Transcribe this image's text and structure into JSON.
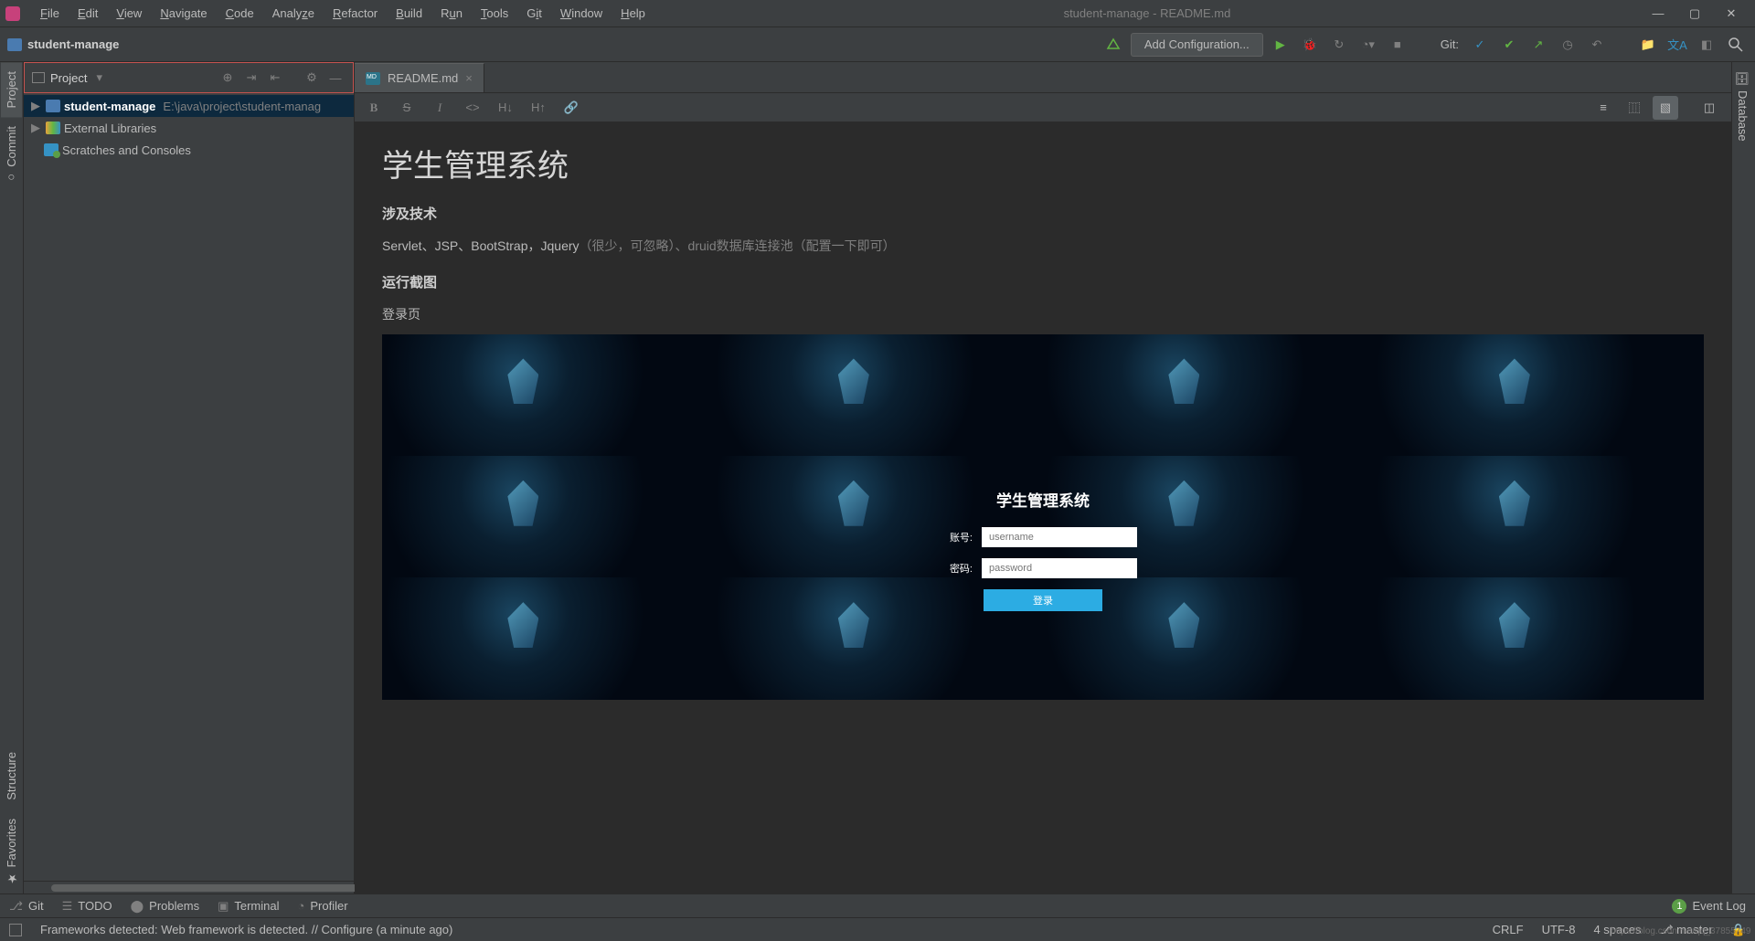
{
  "window": {
    "title": "student-manage - README.md",
    "menus": [
      "File",
      "Edit",
      "View",
      "Navigate",
      "Code",
      "Analyze",
      "Refactor",
      "Build",
      "Run",
      "Tools",
      "Git",
      "Window",
      "Help"
    ]
  },
  "breadcrumb": {
    "project": "student-manage"
  },
  "toolbar": {
    "add_config": "Add Configuration...",
    "git_label": "Git:"
  },
  "left_gutter": {
    "tabs": [
      "Project",
      "Commit"
    ]
  },
  "left_gutter_bottom": {
    "tabs": [
      "Structure",
      "Favorites"
    ]
  },
  "right_gutter": {
    "tabs": [
      "Database"
    ]
  },
  "project_panel": {
    "label": "Project",
    "tree": [
      {
        "name": "student-manage",
        "path": "E:\\java\\project\\student-manag",
        "icon": "folder",
        "selected": true,
        "arrow": "▶"
      },
      {
        "name": "External Libraries",
        "icon": "lib",
        "arrow": "▶"
      },
      {
        "name": "Scratches and Consoles",
        "icon": "scratch",
        "arrow": ""
      }
    ]
  },
  "editor": {
    "tab": {
      "name": "README.md"
    },
    "md_toolbar": [
      "B",
      "S",
      "I",
      "</>",
      "H↓",
      "H↑",
      "🔗"
    ]
  },
  "preview": {
    "h1": "学生管理系统",
    "h3a": "涉及技术",
    "tech_line_main": "Servlet、JSP、BootStrap，Jquery",
    "tech_line_dim": "（很少，可忽略）、druid数据库连接池（配置一下即可）",
    "h3b": "运行截图",
    "p_login": "登录页",
    "login": {
      "title": "学生管理系统",
      "user_label": "账号:",
      "user_ph": "username",
      "pass_label": "密码:",
      "pass_ph": "password",
      "btn": "登录"
    }
  },
  "bottom": {
    "git": "Git",
    "todo": "TODO",
    "problems": "Problems",
    "terminal": "Terminal",
    "profiler": "Profiler",
    "event_log": "Event Log",
    "event_count": "1"
  },
  "status": {
    "msg": "Frameworks detected: Web framework is detected. // Configure (a minute ago)",
    "crlf": "CRLF",
    "enc": "UTF-8",
    "spaces": "4 spaces",
    "branch": "master"
  },
  "watermark": "https://blog.csdn.net/qq_37855749"
}
